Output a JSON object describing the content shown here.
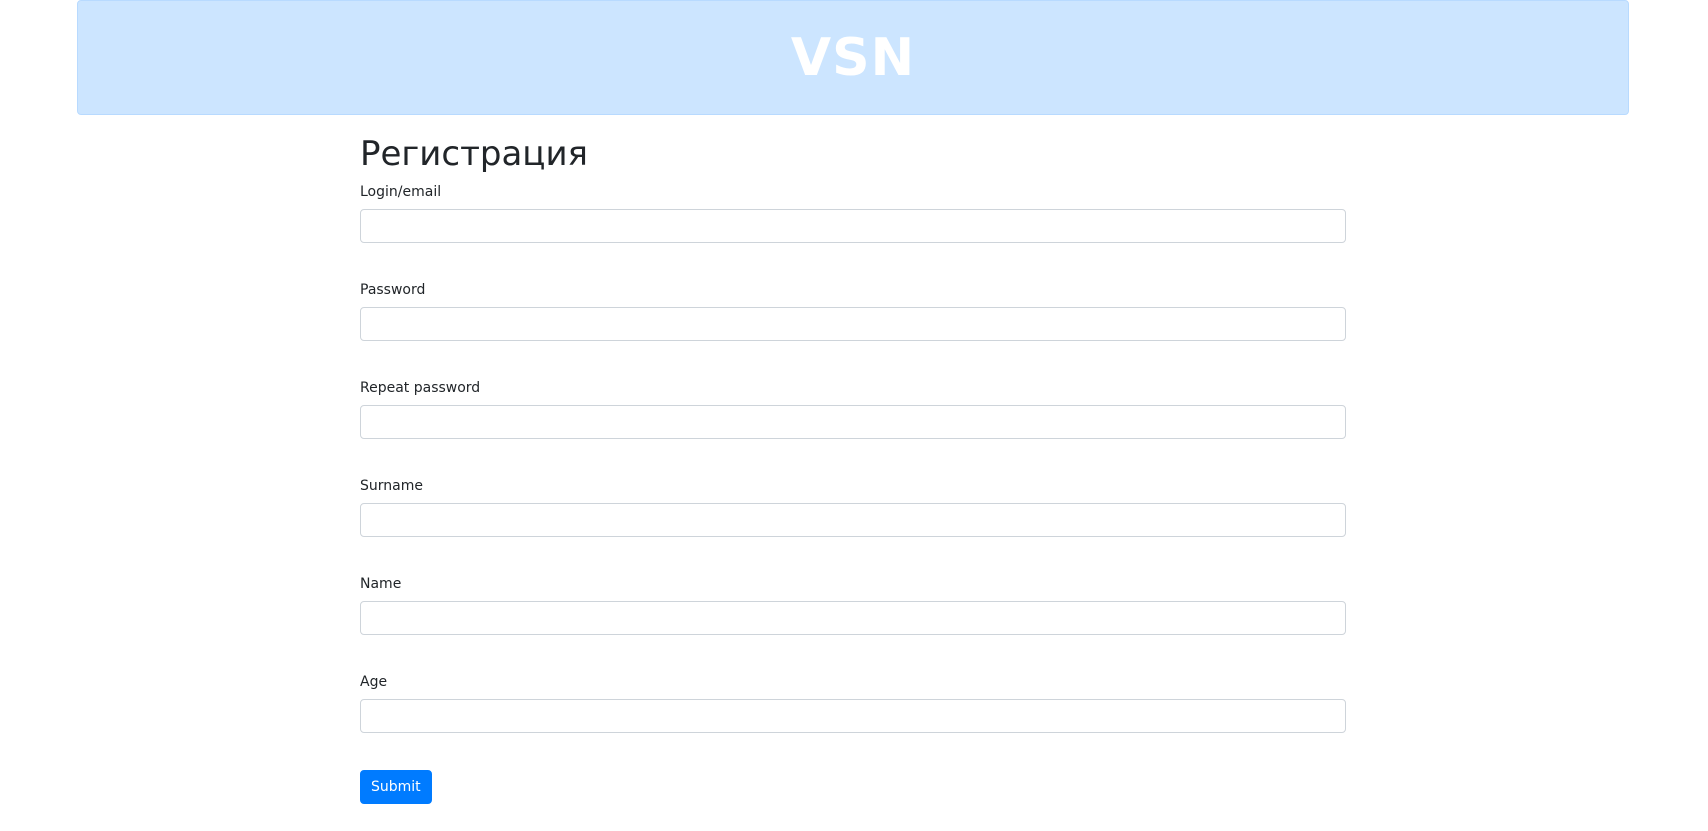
{
  "header": {
    "brand": "VSN",
    "background_color": "#cce5ff"
  },
  "page_title": "Регистрация",
  "form": {
    "fields": [
      {
        "label": "Login/email",
        "value": "",
        "placeholder": ""
      },
      {
        "label": "Password",
        "value": "",
        "placeholder": ""
      },
      {
        "label": "Repeat password",
        "value": "",
        "placeholder": ""
      },
      {
        "label": "Surname",
        "value": "",
        "placeholder": ""
      },
      {
        "label": "Name",
        "value": "",
        "placeholder": ""
      },
      {
        "label": "Age",
        "value": "",
        "placeholder": ""
      }
    ],
    "submit_label": "Submit",
    "submit_color": "#007bff"
  }
}
